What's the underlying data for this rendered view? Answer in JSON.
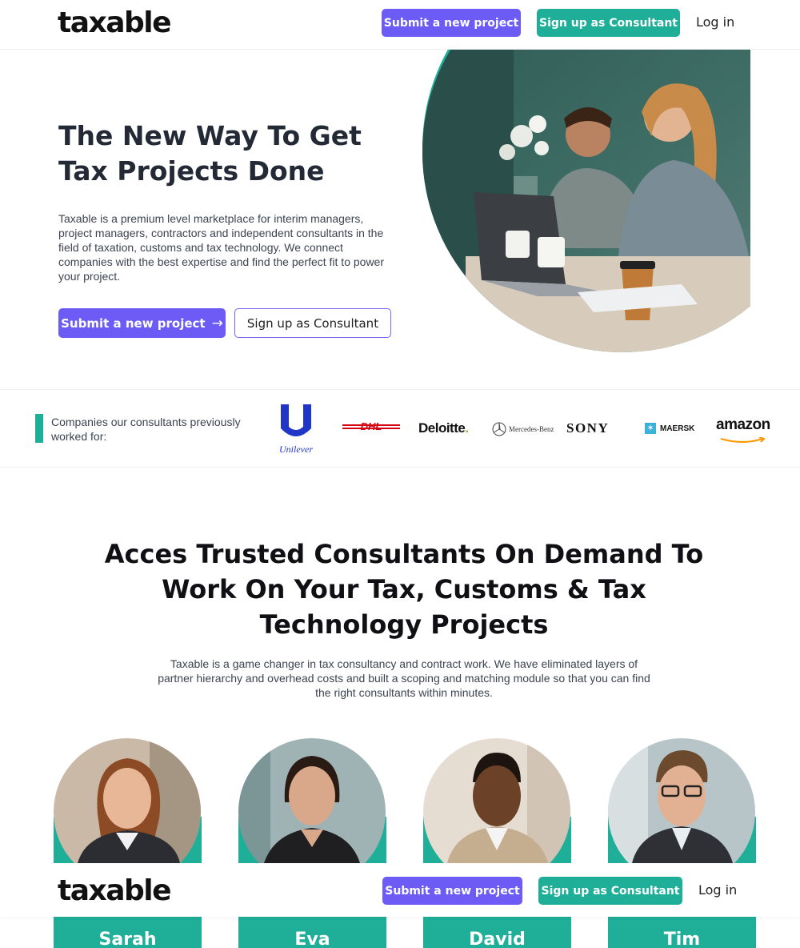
{
  "header": {
    "logo": "taxable",
    "submit_label": "Submit a new project",
    "signup_label": "Sign up as Consultant",
    "login_label": "Log in"
  },
  "hero": {
    "title_line1": "The New Way To Get",
    "title_line2": "Tax Projects Done",
    "description": "Taxable is a premium level marketplace for interim managers, project managers, contractors and independent consultants in the field of taxation, customs and tax technology. We connect companies with the best expertise and find the perfect fit to power your project.",
    "primary_button": "Submit a new project",
    "primary_arrow": "→",
    "secondary_button": "Sign up as Consultant"
  },
  "companies": {
    "label": "Companies our consultants previously worked for:",
    "logos": {
      "unilever": "Unilever",
      "dhl": "DHL",
      "deloitte": "Deloitte",
      "deloitte_dot": ".",
      "mercedes": "Mercedes-Benz",
      "sony": "SONY",
      "maersk": "MAERSK",
      "amazon": "amazon"
    }
  },
  "section": {
    "title_line1": "Acces Trusted Consultants On Demand To",
    "title_line2": "Work On Your Tax, Customs & Tax",
    "title_line3": "Technology Projects",
    "description": "Taxable is a game changer in tax consultancy and contract work. We have eliminated layers of partner hierarchy and overhead costs and built a scoping and matching module so that you can find the right consultants within minutes."
  },
  "consultants": [
    {
      "name": "Sarah"
    },
    {
      "name": "Eva"
    },
    {
      "name": "David"
    },
    {
      "name": "Tim"
    }
  ],
  "colors": {
    "purple": "#6c5cf5",
    "teal": "#1fae98",
    "dark_text": "#232a36"
  }
}
